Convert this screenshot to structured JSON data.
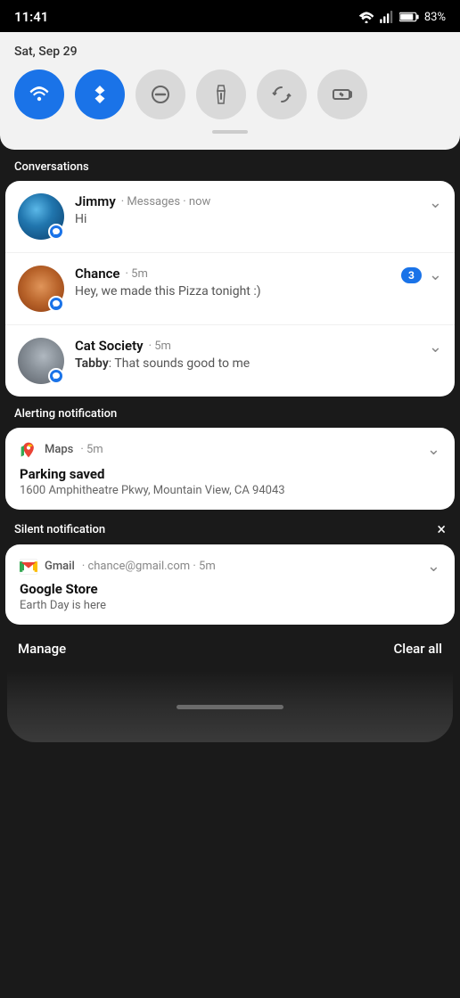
{
  "statusBar": {
    "time": "11:41",
    "battery": "83%",
    "wifi": "wifi-icon",
    "signal": "signal-icon",
    "batteryIcon": "battery-icon"
  },
  "quickSettings": {
    "date": "Sat, Sep 29",
    "toggles": [
      {
        "id": "wifi",
        "label": "WiFi",
        "active": true
      },
      {
        "id": "bluetooth",
        "label": "Bluetooth",
        "active": true
      },
      {
        "id": "dnd",
        "label": "Do Not Disturb",
        "active": false
      },
      {
        "id": "flashlight",
        "label": "Flashlight",
        "active": false
      },
      {
        "id": "rotation",
        "label": "Auto Rotate",
        "active": false
      },
      {
        "id": "battery-saver",
        "label": "Battery Saver",
        "active": false
      }
    ]
  },
  "conversations": {
    "sectionLabel": "Conversations",
    "items": [
      {
        "id": "jimmy",
        "name": "Jimmy",
        "app": "Messages",
        "time": "now",
        "message": "Hi",
        "badge": null
      },
      {
        "id": "chance",
        "name": "Chance",
        "app": "Messages",
        "time": "5m",
        "message": "Hey, we made this Pizza tonight :)",
        "badge": "3"
      },
      {
        "id": "cat-society",
        "name": "Cat Society",
        "app": "Messages",
        "time": "5m",
        "sender": "Tabby",
        "message": "That sounds good to me",
        "badge": null
      }
    ]
  },
  "alertingNotification": {
    "sectionLabel": "Alerting notification",
    "app": "Maps",
    "time": "5m",
    "title": "Parking saved",
    "text": "1600 Amphitheatre Pkwy, Mountain View, CA 94043"
  },
  "silentNotification": {
    "sectionLabel": "Silent notification",
    "closeLabel": "×",
    "app": "Gmail",
    "email": "chance@gmail.com",
    "time": "5m",
    "title": "Google Store",
    "text": "Earth Day is here"
  },
  "bottomBar": {
    "manageLabel": "Manage",
    "clearAllLabel": "Clear all"
  }
}
